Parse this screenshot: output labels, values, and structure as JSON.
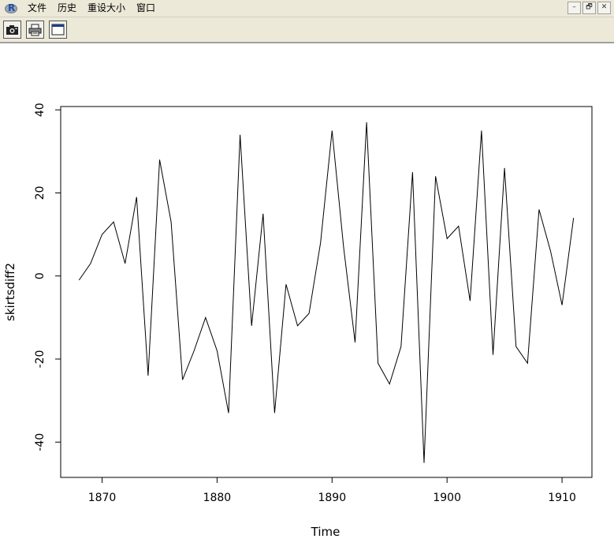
{
  "menubar": {
    "items": [
      "文件",
      "历史",
      "重设大小",
      "窗口"
    ],
    "logo_letter": "R"
  },
  "window_controls": [
    "–",
    "🗗",
    "✕"
  ],
  "toolbar": {
    "buttons": [
      "copy-as-image",
      "print",
      "new-window"
    ]
  },
  "chart_data": {
    "type": "line",
    "xlabel": "Time",
    "ylabel": "skirtsdiff2",
    "xlim": [
      1866.4,
      1912.6
    ],
    "ylim": [
      -48.5,
      40.8
    ],
    "xticks": [
      1870,
      1880,
      1890,
      1900,
      1910
    ],
    "yticks": [
      -40,
      -20,
      0,
      20,
      40
    ],
    "x": [
      1868,
      1869,
      1870,
      1871,
      1872,
      1873,
      1874,
      1875,
      1876,
      1877,
      1878,
      1879,
      1880,
      1881,
      1882,
      1883,
      1884,
      1885,
      1886,
      1887,
      1888,
      1889,
      1890,
      1891,
      1892,
      1893,
      1894,
      1895,
      1896,
      1897,
      1898,
      1899,
      1900,
      1901,
      1902,
      1903,
      1904,
      1905,
      1906,
      1907,
      1908,
      1909,
      1910,
      1911
    ],
    "values": [
      -1,
      3,
      10,
      13,
      3,
      19,
      -24,
      28,
      13,
      -25,
      -18,
      -10,
      -18,
      -33,
      34,
      -12,
      15,
      -33,
      -2,
      -12,
      -9,
      8,
      35,
      7,
      -16,
      37,
      -21,
      -26,
      -17,
      25,
      -45,
      24,
      9,
      12,
      -6,
      35,
      -19,
      26,
      -17,
      -21,
      16,
      6,
      -7,
      14
    ]
  }
}
